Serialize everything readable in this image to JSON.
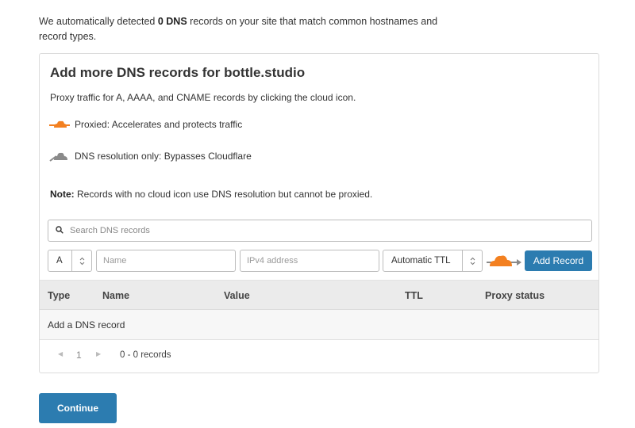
{
  "intro": {
    "before": "We automatically detected ",
    "count_bold": "0 DNS",
    "after": " records on your site that match common hostnames and record types."
  },
  "card": {
    "title": "Add more DNS records for bottle.studio",
    "description": "Proxy traffic for A, AAAA, and CNAME records by clicking the cloud icon.",
    "proxied_label": "Proxied: Accelerates and protects traffic",
    "dns_only_label": "DNS resolution only: Bypasses Cloudflare",
    "note_bold": "Note:",
    "note_text": " Records with no cloud icon use DNS resolution but cannot be proxied."
  },
  "form": {
    "search_placeholder": "Search DNS records",
    "type_value": "A",
    "name_placeholder": "Name",
    "value_placeholder": "IPv4 address",
    "ttl_value": "Automatic TTL",
    "add_label": "Add Record"
  },
  "table": {
    "columns": [
      "Type",
      "Name",
      "Value",
      "TTL",
      "Proxy status"
    ],
    "empty_row": "Add a DNS record"
  },
  "pager": {
    "current_page": "1",
    "records_text": "0 - 0 records"
  },
  "continue_label": "Continue",
  "colors": {
    "accent": "#2c7cb0",
    "proxied_cloud": "#f38020",
    "dns_cloud": "#8a8a8a"
  }
}
